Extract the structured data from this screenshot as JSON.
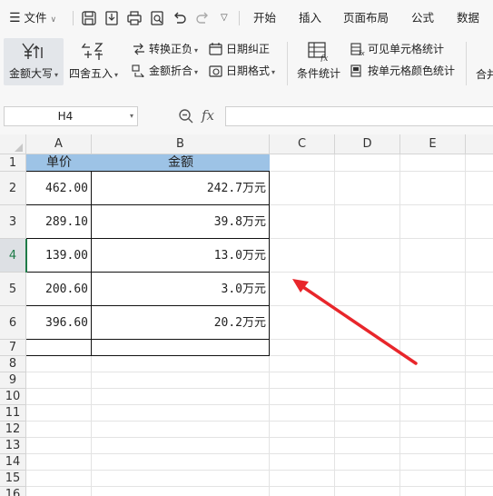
{
  "menubar": {
    "file_label": "文件",
    "tabs": [
      "开始",
      "插入",
      "页面布局",
      "公式",
      "数据"
    ]
  },
  "ribbon": {
    "amount_upper": "金额大写",
    "round": "四舍五入",
    "convert_sign": "转换正负",
    "date_fix": "日期纠正",
    "visible_stats": "可见单元格统计",
    "amount_fold": "金额折合",
    "date_format": "日期格式",
    "cond_stats": "条件统计",
    "color_stats": "按单元格颜色统计",
    "merge_partial": "合并"
  },
  "formula_bar": {
    "name_box": "H4",
    "fx": "fx",
    "formula": ""
  },
  "sheet": {
    "columns": [
      "A",
      "B",
      "C",
      "D",
      "E"
    ],
    "rows": [
      "1",
      "2",
      "3",
      "4",
      "5",
      "6",
      "7",
      "8",
      "9",
      "10",
      "11",
      "12",
      "13",
      "14",
      "15",
      "16"
    ],
    "selected_row": "4",
    "header": {
      "a": "单价",
      "b": "金额"
    },
    "data": [
      {
        "a": "462.00",
        "b": "242.7万元"
      },
      {
        "a": "289.10",
        "b": "39.8万元"
      },
      {
        "a": "139.00",
        "b": "13.0万元"
      },
      {
        "a": "200.60",
        "b": "3.0万元"
      },
      {
        "a": "396.60",
        "b": "20.2万元"
      }
    ]
  },
  "colors": {
    "header_fill": "#9dc3e6",
    "arrow": "#e8262b",
    "selection": "#1e7b48"
  }
}
